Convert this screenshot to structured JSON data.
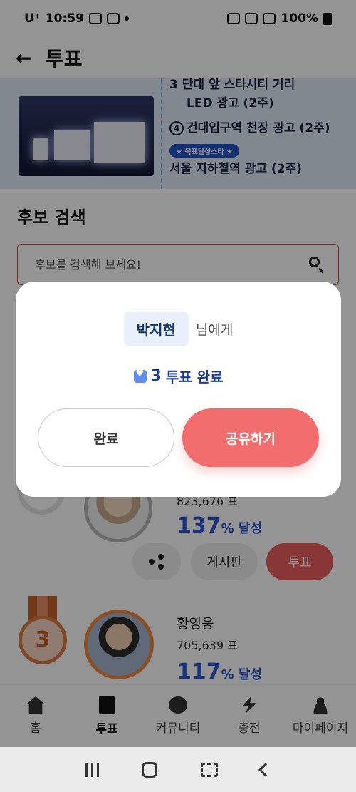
{
  "status_bar": {
    "carrier": "U⁺",
    "time": "10:59",
    "battery": "100%"
  },
  "header": {
    "back_icon": "←",
    "title": "투표"
  },
  "banner": {
    "line3_top": "3 단대 앞 스타시티 거리",
    "line3_bottom": "LED 광고 (2주)",
    "line4_num": "4",
    "line4": "건대입구역 천장 광고 (2주)",
    "tag": "★ 목표달성스타 ★",
    "line5": "서울 지하철역 광고 (2주)"
  },
  "search": {
    "title": "후보 검색",
    "placeholder": "후보를 검색해 보세요!"
  },
  "candidate2": {
    "votes": "823,676 표",
    "rate_num": "137",
    "rate_unit": "% 달성",
    "board": "게시판",
    "vote": "투표"
  },
  "candidate3": {
    "rank": "3",
    "name": "황영웅",
    "votes": "705,639 표",
    "rate_num": "117",
    "rate_unit": "% 달성"
  },
  "tabs": [
    {
      "label": "홈",
      "icon": "home-icon"
    },
    {
      "label": "투표",
      "icon": "vote-icon"
    },
    {
      "label": "커뮤니티",
      "icon": "chat-icon"
    },
    {
      "label": "충전",
      "icon": "bolt-icon"
    },
    {
      "label": "마이페이지",
      "icon": "user-icon"
    }
  ],
  "modal": {
    "recipient_name": "박지현",
    "recipient_suffix": "님에게",
    "vote_count": "3",
    "vote_done": "투표 완료",
    "done_button": "완료",
    "share_button": "공유하기"
  },
  "colors": {
    "accent": "#f26d6d",
    "primary_blue": "#2a57d6",
    "dim": "rgba(0,0,0,0.42)"
  }
}
